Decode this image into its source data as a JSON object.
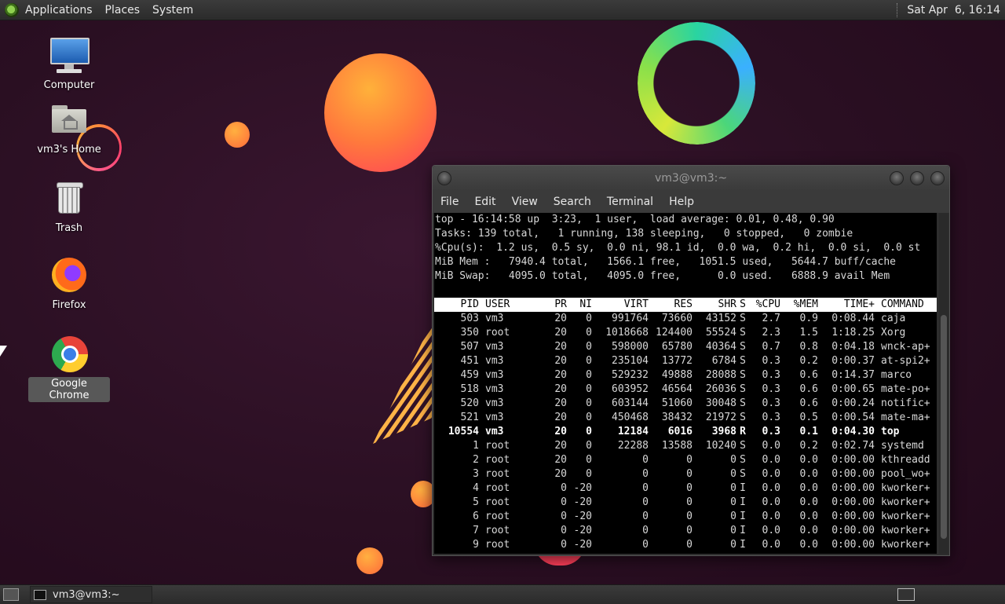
{
  "top_panel": {
    "menus": [
      "Applications",
      "Places",
      "System"
    ],
    "clock": "Sat Apr  6, 16:14"
  },
  "desktop_icons": [
    {
      "label": "Computer",
      "icon": "computer-icon"
    },
    {
      "label": "vm3's Home",
      "icon": "home-folder-icon"
    },
    {
      "label": "Trash",
      "icon": "trash-icon"
    },
    {
      "label": "Firefox",
      "icon": "firefox-icon"
    },
    {
      "label": "Google Chrome",
      "icon": "chrome-icon",
      "selected": true
    }
  ],
  "terminal": {
    "title": "vm3@vm3:~",
    "menu": [
      "File",
      "Edit",
      "View",
      "Search",
      "Terminal",
      "Help"
    ],
    "summary": [
      "top - 16:14:58 up  3:23,  1 user,  load average: 0.01, 0.48, 0.90",
      "Tasks: 139 total,   1 running, 138 sleeping,   0 stopped,   0 zombie",
      "%Cpu(s):  1.2 us,  0.5 sy,  0.0 ni, 98.1 id,  0.0 wa,  0.2 hi,  0.0 si,  0.0 st",
      "MiB Mem :   7940.4 total,   1566.1 free,   1051.5 used,   5644.7 buff/cache",
      "MiB Swap:   4095.0 total,   4095.0 free,      0.0 used.   6888.9 avail Mem"
    ],
    "columns": [
      "PID",
      "USER",
      "PR",
      "NI",
      "VIRT",
      "RES",
      "SHR",
      "S",
      "%CPU",
      "%MEM",
      "TIME+",
      "COMMAND"
    ],
    "processes": [
      [
        "503",
        "vm3",
        "20",
        "0",
        "991764",
        "73660",
        "43152",
        "S",
        "2.7",
        "0.9",
        "0:08.44",
        "caja"
      ],
      [
        "350",
        "root",
        "20",
        "0",
        "1018668",
        "124400",
        "55524",
        "S",
        "2.3",
        "1.5",
        "1:18.25",
        "Xorg"
      ],
      [
        "507",
        "vm3",
        "20",
        "0",
        "598000",
        "65780",
        "40364",
        "S",
        "0.7",
        "0.8",
        "0:04.18",
        "wnck-ap+"
      ],
      [
        "451",
        "vm3",
        "20",
        "0",
        "235104",
        "13772",
        "6784",
        "S",
        "0.3",
        "0.2",
        "0:00.37",
        "at-spi2+"
      ],
      [
        "459",
        "vm3",
        "20",
        "0",
        "529232",
        "49888",
        "28088",
        "S",
        "0.3",
        "0.6",
        "0:14.37",
        "marco"
      ],
      [
        "518",
        "vm3",
        "20",
        "0",
        "603952",
        "46564",
        "26036",
        "S",
        "0.3",
        "0.6",
        "0:00.65",
        "mate-po+"
      ],
      [
        "520",
        "vm3",
        "20",
        "0",
        "603144",
        "51060",
        "30048",
        "S",
        "0.3",
        "0.6",
        "0:00.24",
        "notific+"
      ],
      [
        "521",
        "vm3",
        "20",
        "0",
        "450468",
        "38432",
        "21972",
        "S",
        "0.3",
        "0.5",
        "0:00.54",
        "mate-ma+"
      ],
      [
        "10554",
        "vm3",
        "20",
        "0",
        "12184",
        "6016",
        "3968",
        "R",
        "0.3",
        "0.1",
        "0:04.30",
        "top"
      ],
      [
        "1",
        "root",
        "20",
        "0",
        "22288",
        "13588",
        "10240",
        "S",
        "0.0",
        "0.2",
        "0:02.74",
        "systemd"
      ],
      [
        "2",
        "root",
        "20",
        "0",
        "0",
        "0",
        "0",
        "S",
        "0.0",
        "0.0",
        "0:00.00",
        "kthreadd"
      ],
      [
        "3",
        "root",
        "20",
        "0",
        "0",
        "0",
        "0",
        "S",
        "0.0",
        "0.0",
        "0:00.00",
        "pool_wo+"
      ],
      [
        "4",
        "root",
        "0",
        "-20",
        "0",
        "0",
        "0",
        "I",
        "0.0",
        "0.0",
        "0:00.00",
        "kworker+"
      ],
      [
        "5",
        "root",
        "0",
        "-20",
        "0",
        "0",
        "0",
        "I",
        "0.0",
        "0.0",
        "0:00.00",
        "kworker+"
      ],
      [
        "6",
        "root",
        "0",
        "-20",
        "0",
        "0",
        "0",
        "I",
        "0.0",
        "0.0",
        "0:00.00",
        "kworker+"
      ],
      [
        "7",
        "root",
        "0",
        "-20",
        "0",
        "0",
        "0",
        "I",
        "0.0",
        "0.0",
        "0:00.00",
        "kworker+"
      ],
      [
        "9",
        "root",
        "0",
        "-20",
        "0",
        "0",
        "0",
        "I",
        "0.0",
        "0.0",
        "0:00.00",
        "kworker+"
      ]
    ],
    "highlighted_row": 8
  },
  "bottom_panel": {
    "task_label": "vm3@vm3:~"
  }
}
